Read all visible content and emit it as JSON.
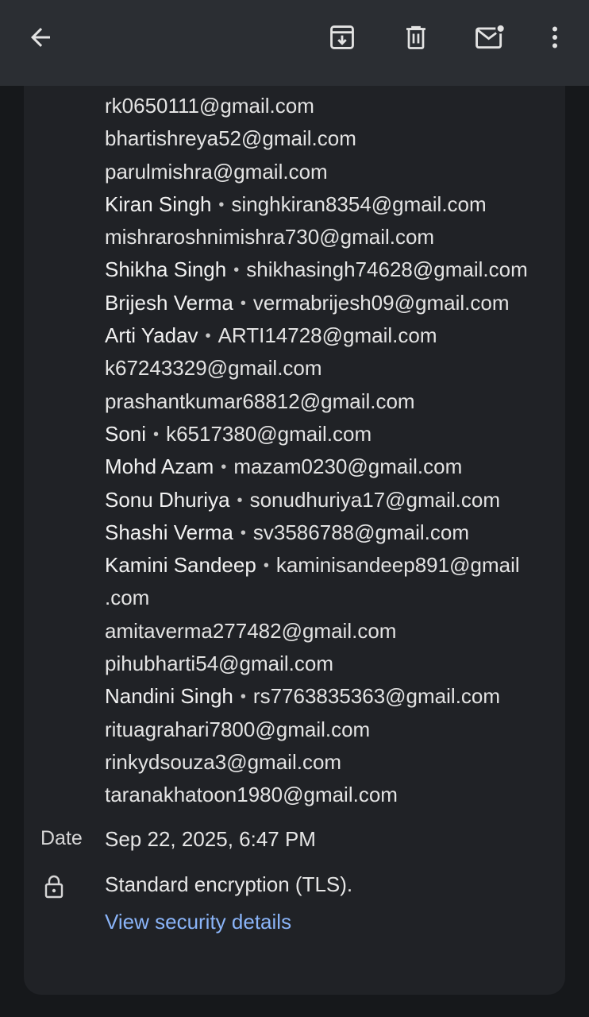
{
  "toolbar": {
    "back": "back-arrow-icon",
    "archive": "archive-icon",
    "delete": "trash-icon",
    "mark_unread": "mark-unread-icon",
    "more": "more-vertical-icon"
  },
  "recipients": [
    {
      "name": "",
      "email": "rk0650111@gmail.com"
    },
    {
      "name": "",
      "email": "bhartishreya52@gmail.com"
    },
    {
      "name": "",
      "email": "parulmishra@gmail.com"
    },
    {
      "name": "Kiran Singh",
      "email": "singhkiran8354@gmail.com"
    },
    {
      "name": "",
      "email": "mishraroshnimishra730@gmail.com"
    },
    {
      "name": "Shikha Singh",
      "email": "shikhasingh74628@gmail.com"
    },
    {
      "name": "Brijesh Verma",
      "email": "vermabrijesh09@gmail.com"
    },
    {
      "name": "Arti Yadav",
      "email": "ARTI14728@gmail.com"
    },
    {
      "name": "",
      "email": "k67243329@gmail.com"
    },
    {
      "name": "",
      "email": "prashantkumar68812@gmail.com"
    },
    {
      "name": "Soni",
      "email": "k6517380@gmail.com"
    },
    {
      "name": "Mohd Azam",
      "email": "mazam0230@gmail.com"
    },
    {
      "name": "Sonu Dhuriya",
      "email": "sonudhuriya17@gmail.com"
    },
    {
      "name": "Shashi Verma",
      "email": "sv3586788@gmail.com"
    },
    {
      "name": "Kamini Sandeep",
      "email": "kaminisandeep891@gmail",
      "email_wrap": ".com"
    },
    {
      "name": "",
      "email": "amitaverma277482@gmail.com"
    },
    {
      "name": "",
      "email": "pihubharti54@gmail.com"
    },
    {
      "name": "Nandini Singh",
      "email": "rs7763835363@gmail.com"
    },
    {
      "name": "",
      "email": "rituagrahari7800@gmail.com"
    },
    {
      "name": "",
      "email": "rinkydsouza3@gmail.com"
    },
    {
      "name": "",
      "email": "taranakhatoon1980@gmail.com"
    }
  ],
  "separator": "•",
  "date": {
    "label": "Date",
    "value": "Sep 22, 2025, 6:47 PM"
  },
  "security": {
    "icon": "lock-icon",
    "text": "Standard encryption (TLS).",
    "link": "View security details"
  },
  "colors": {
    "background": "#16181b",
    "topbar": "#2b2e33",
    "card": "#202226",
    "link": "#8ab4f8"
  }
}
